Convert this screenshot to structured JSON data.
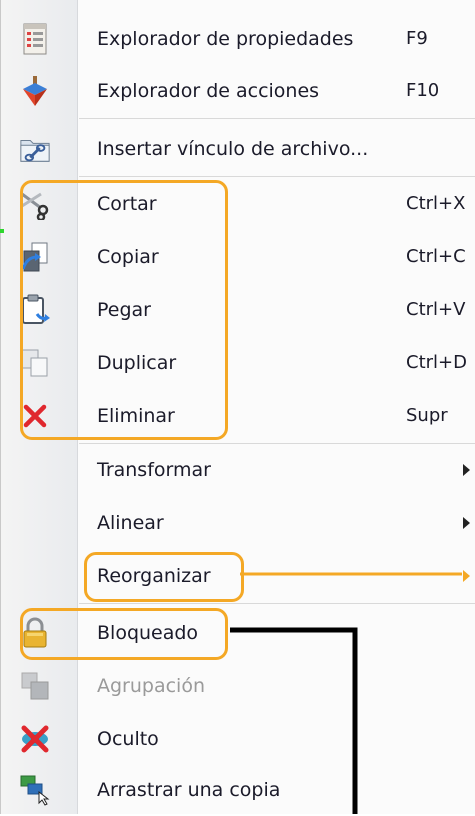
{
  "menu": {
    "items": [
      {
        "label": "Explorador de propiedades",
        "shortcut": "F9",
        "icon": "property-explorer-icon"
      },
      {
        "label": "Explorador de acciones",
        "shortcut": "F10",
        "icon": "action-explorer-icon"
      },
      {
        "label": "Insertar vínculo de archivo...",
        "shortcut": "",
        "icon": "file-link-icon"
      },
      {
        "label": "Cortar",
        "shortcut": "Ctrl+X",
        "icon": "scissors-icon"
      },
      {
        "label": "Copiar",
        "shortcut": "Ctrl+C",
        "icon": "copy-icon"
      },
      {
        "label": "Pegar",
        "shortcut": "Ctrl+V",
        "icon": "paste-icon"
      },
      {
        "label": "Duplicar",
        "shortcut": "Ctrl+D",
        "icon": "duplicate-icon"
      },
      {
        "label": "Eliminar",
        "shortcut": "Supr",
        "icon": "delete-icon"
      },
      {
        "label": "Transformar",
        "shortcut": "",
        "icon": "",
        "submenu": true
      },
      {
        "label": "Alinear",
        "shortcut": "",
        "icon": "",
        "submenu": true
      },
      {
        "label": "Reorganizar",
        "shortcut": "",
        "icon": "",
        "submenu": true
      },
      {
        "label": "Bloqueado",
        "shortcut": "",
        "icon": "lock-icon"
      },
      {
        "label": "Agrupación",
        "shortcut": "",
        "icon": "group-icon",
        "disabled": true
      },
      {
        "label": "Oculto",
        "shortcut": "",
        "icon": "hidden-icon"
      },
      {
        "label": "Arrastrar una copia",
        "shortcut": "",
        "icon": "drag-copy-icon"
      }
    ]
  },
  "colors": {
    "highlight": "#f4a825",
    "annotation_black": "#000000",
    "delete_red": "#e0282e",
    "indicator_green": "#2ed62e"
  }
}
